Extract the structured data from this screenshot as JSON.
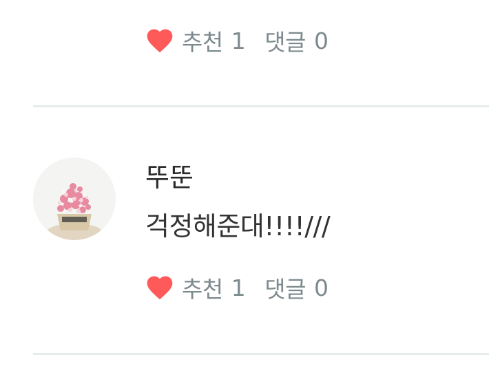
{
  "comments": [
    {
      "like_label": "추천",
      "like_count": "1",
      "reply_label": "댓글",
      "reply_count": "0"
    },
    {
      "author": "뚜뚠",
      "text": "걱정해준대!!!!///",
      "like_label": "추천",
      "like_count": "1",
      "reply_label": "댓글",
      "reply_count": "0"
    }
  ],
  "colors": {
    "heart": "#ff5a5a",
    "meta_text": "#7c8a8d",
    "divider": "#e6ece9"
  },
  "icons": {
    "like": "heart-icon",
    "avatar": "flower-bouquet-avatar"
  }
}
